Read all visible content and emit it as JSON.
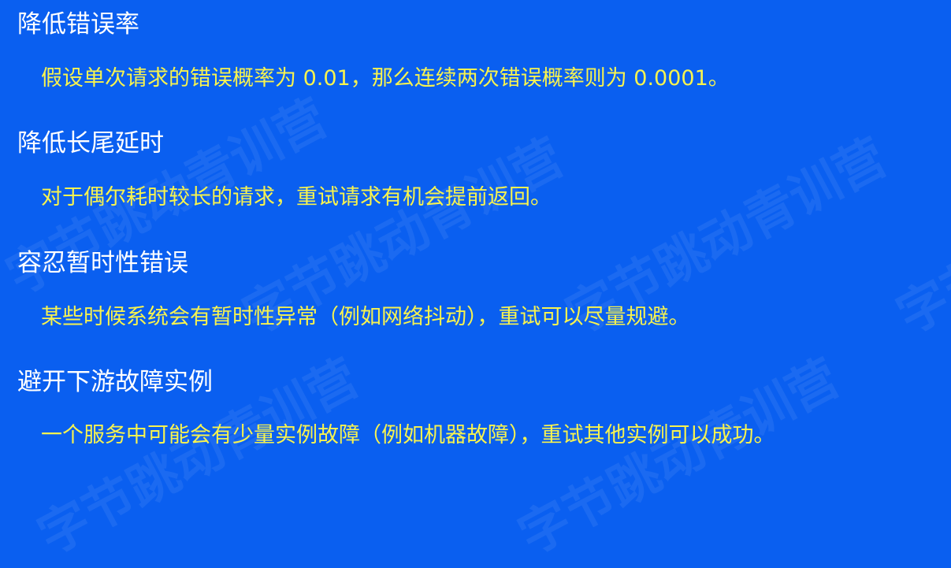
{
  "watermark_text": "字节跳动青训营",
  "colors": {
    "background": "#0a5ff0",
    "heading": "#ffffff",
    "body": "#f7f34f"
  },
  "sections": [
    {
      "heading": "降低错误率",
      "body": "假设单次请求的错误概率为 0.01，那么连续两次错误概率则为 0.0001。"
    },
    {
      "heading": "降低长尾延时",
      "body": "对于偶尔耗时较长的请求，重试请求有机会提前返回。"
    },
    {
      "heading": "容忍暂时性错误",
      "body": "某些时候系统会有暂时性异常（例如网络抖动），重试可以尽量规避。"
    },
    {
      "heading": "避开下游故障实例",
      "body": "一个服务中可能会有少量实例故障（例如机器故障），重试其他实例可以成功。"
    }
  ]
}
